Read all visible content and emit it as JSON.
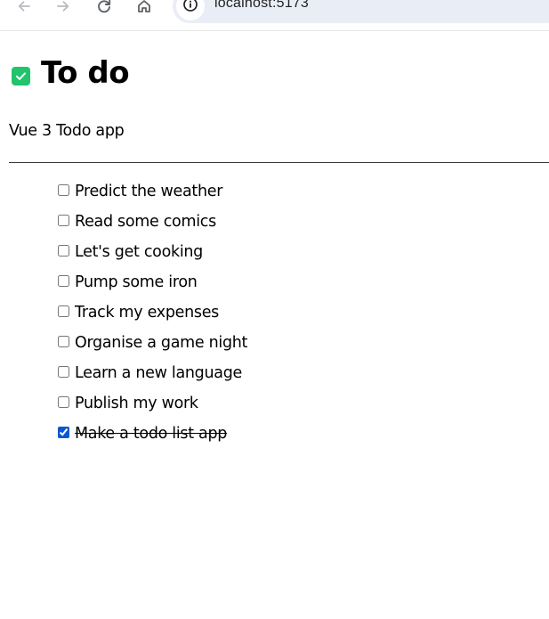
{
  "browser": {
    "url": "localhost:5173",
    "icons": {
      "back": "arrow-left-icon",
      "forward": "arrow-right-icon",
      "reload": "reload-icon",
      "home": "home-icon",
      "info": "info-icon"
    }
  },
  "app": {
    "title": "To do",
    "subtitle": "Vue 3 Todo app",
    "accent_color": "#1fc46b"
  },
  "todos": [
    {
      "label": "Predict the weather",
      "done": false
    },
    {
      "label": "Read some comics",
      "done": false
    },
    {
      "label": "Let's get cooking",
      "done": false
    },
    {
      "label": "Pump some iron",
      "done": false
    },
    {
      "label": "Track my expenses",
      "done": false
    },
    {
      "label": "Organise a game night",
      "done": false
    },
    {
      "label": "Learn a new language",
      "done": false
    },
    {
      "label": "Publish my work",
      "done": false
    },
    {
      "label": "Make a todo list app",
      "done": true
    }
  ]
}
